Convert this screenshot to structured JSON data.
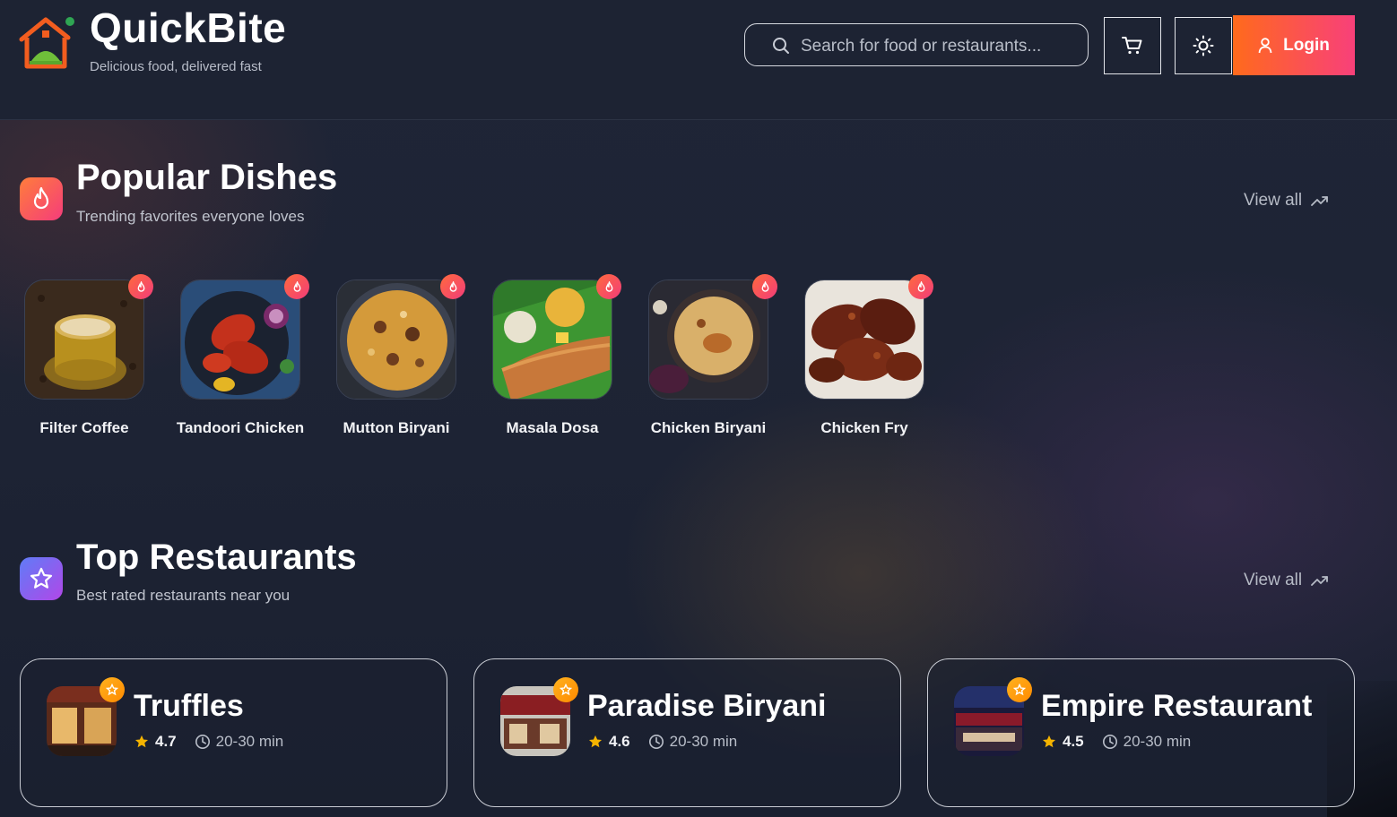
{
  "header": {
    "brand": "QuickBite",
    "tagline": "Delicious food, delivered fast",
    "search_placeholder": "Search for food or restaurants...",
    "login_label": "Login",
    "icons": [
      "house-logo-icon",
      "search-icon",
      "cart-icon",
      "sun-icon",
      "user-icon"
    ]
  },
  "popular": {
    "title": "Popular Dishes",
    "subtitle": "Trending favorites everyone loves",
    "view_all": "View all",
    "dishes": [
      {
        "name": "Filter Coffee"
      },
      {
        "name": "Tandoori Chicken"
      },
      {
        "name": "Mutton Biryani"
      },
      {
        "name": "Masala Dosa"
      },
      {
        "name": "Chicken Biryani"
      },
      {
        "name": "Chicken Fry"
      }
    ]
  },
  "restaurants": {
    "title": "Top Restaurants",
    "subtitle": "Best rated restaurants near you",
    "view_all": "View all",
    "items": [
      {
        "name": "Truffles",
        "rating": "4.7",
        "eta": "20-30 min"
      },
      {
        "name": "Paradise Biryani",
        "rating": "4.6",
        "eta": "20-30 min"
      },
      {
        "name": "Empire Restaurant",
        "rating": "4.5",
        "eta": "20-30 min"
      }
    ]
  },
  "colors": {
    "background": "#1b2131",
    "accent_orange": "#ff6a1c",
    "accent_pink": "#f8407a",
    "star": "#f5b400"
  }
}
